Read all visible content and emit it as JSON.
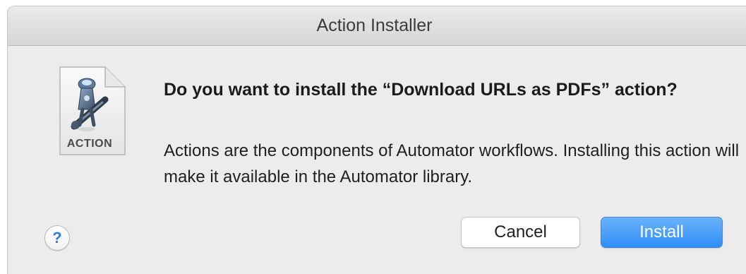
{
  "window": {
    "title": "Action Installer"
  },
  "icon": {
    "name": "automator-action-file-icon",
    "label": "ACTION"
  },
  "dialog": {
    "heading": "Do you want to install the “Download URLs as PDFs” action?",
    "body": "Actions are the components of Automator workflows. Installing this action will make it available in the Automator library."
  },
  "buttons": {
    "help_label": "?",
    "cancel_label": "Cancel",
    "install_label": "Install"
  },
  "colors": {
    "accent": "#2f8ef7",
    "help_glyph": "#2f7de0"
  }
}
